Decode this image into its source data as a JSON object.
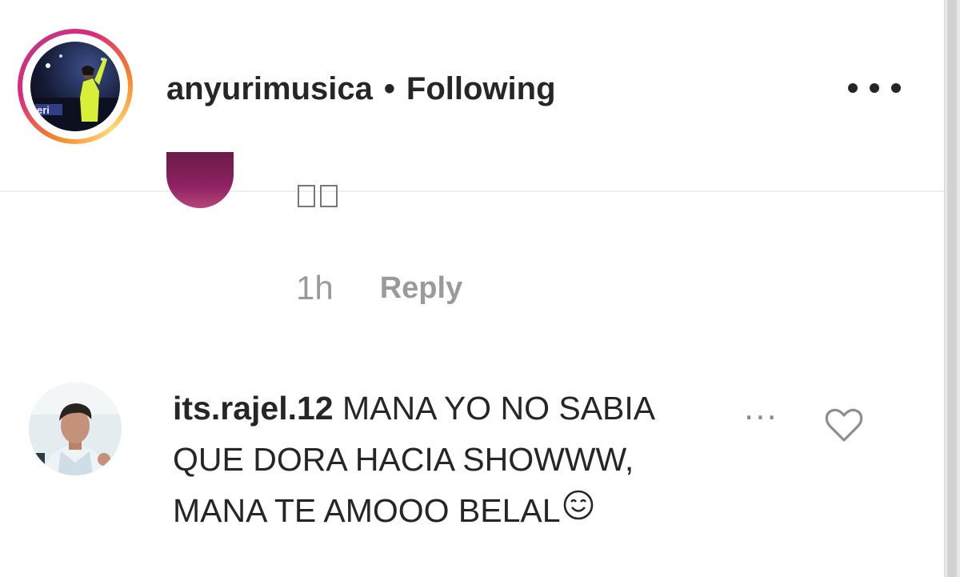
{
  "header": {
    "username": "anyurimusica",
    "separator": "•",
    "follow_state": "Following",
    "more_icon": "more-horizontal-icon"
  },
  "previous_comment": {
    "text_glyphs": "▯▯",
    "time": "1h",
    "reply_label": "Reply"
  },
  "comment": {
    "username": "its.rajel.12",
    "line1": "MANA YO NO SABIA",
    "line2": "QUE DORA HACIA SHOWWW,",
    "line3": "MANA TE AMOOO BELAL",
    "more_label": "...",
    "like_icon": "heart-outline-icon"
  },
  "colors": {
    "text_primary": "#262626",
    "text_secondary": "#9a9a9a",
    "story_ring": [
      "#f58529",
      "#dd2a7b",
      "#c13584"
    ]
  }
}
